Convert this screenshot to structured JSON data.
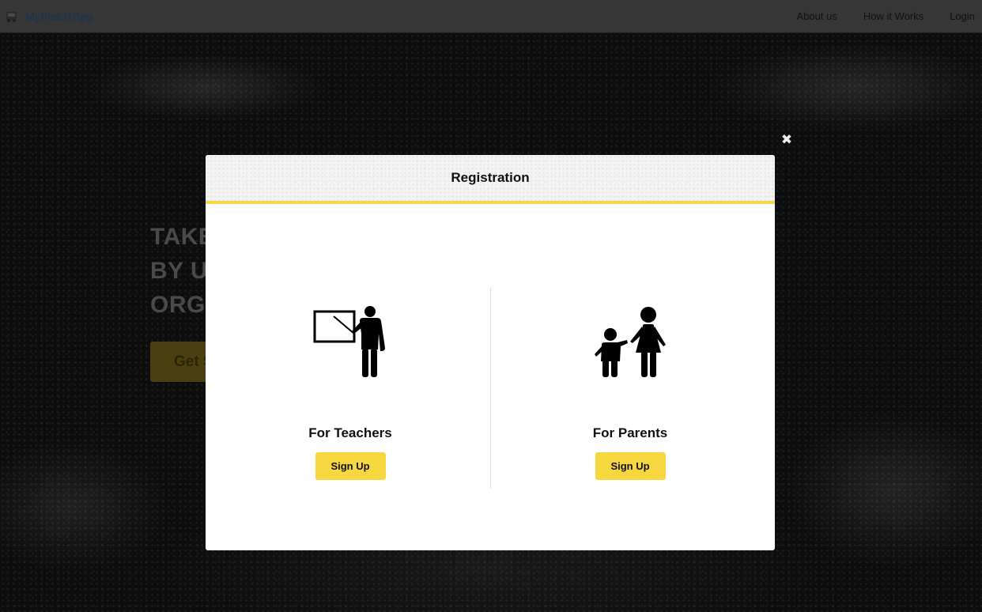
{
  "navbar": {
    "brand": "MyFieldTripp",
    "links": [
      "About us",
      "How it Works",
      "Login"
    ]
  },
  "hero": {
    "title_lines": [
      "TAKE",
      "BY US",
      "ORGA"
    ],
    "cta_label": "Get S"
  },
  "modal": {
    "title": "Registration",
    "close_glyph": "✖",
    "options": [
      {
        "title": "For Teachers",
        "button": "Sign Up",
        "icon": "teacher-icon"
      },
      {
        "title": "For Parents",
        "button": "Sign Up",
        "icon": "parents-children-icon"
      }
    ]
  },
  "colors": {
    "accent": "#f6d740",
    "header_rule": "#f4d848",
    "navbar": "#363636",
    "overlay": "#0d0d0d"
  }
}
